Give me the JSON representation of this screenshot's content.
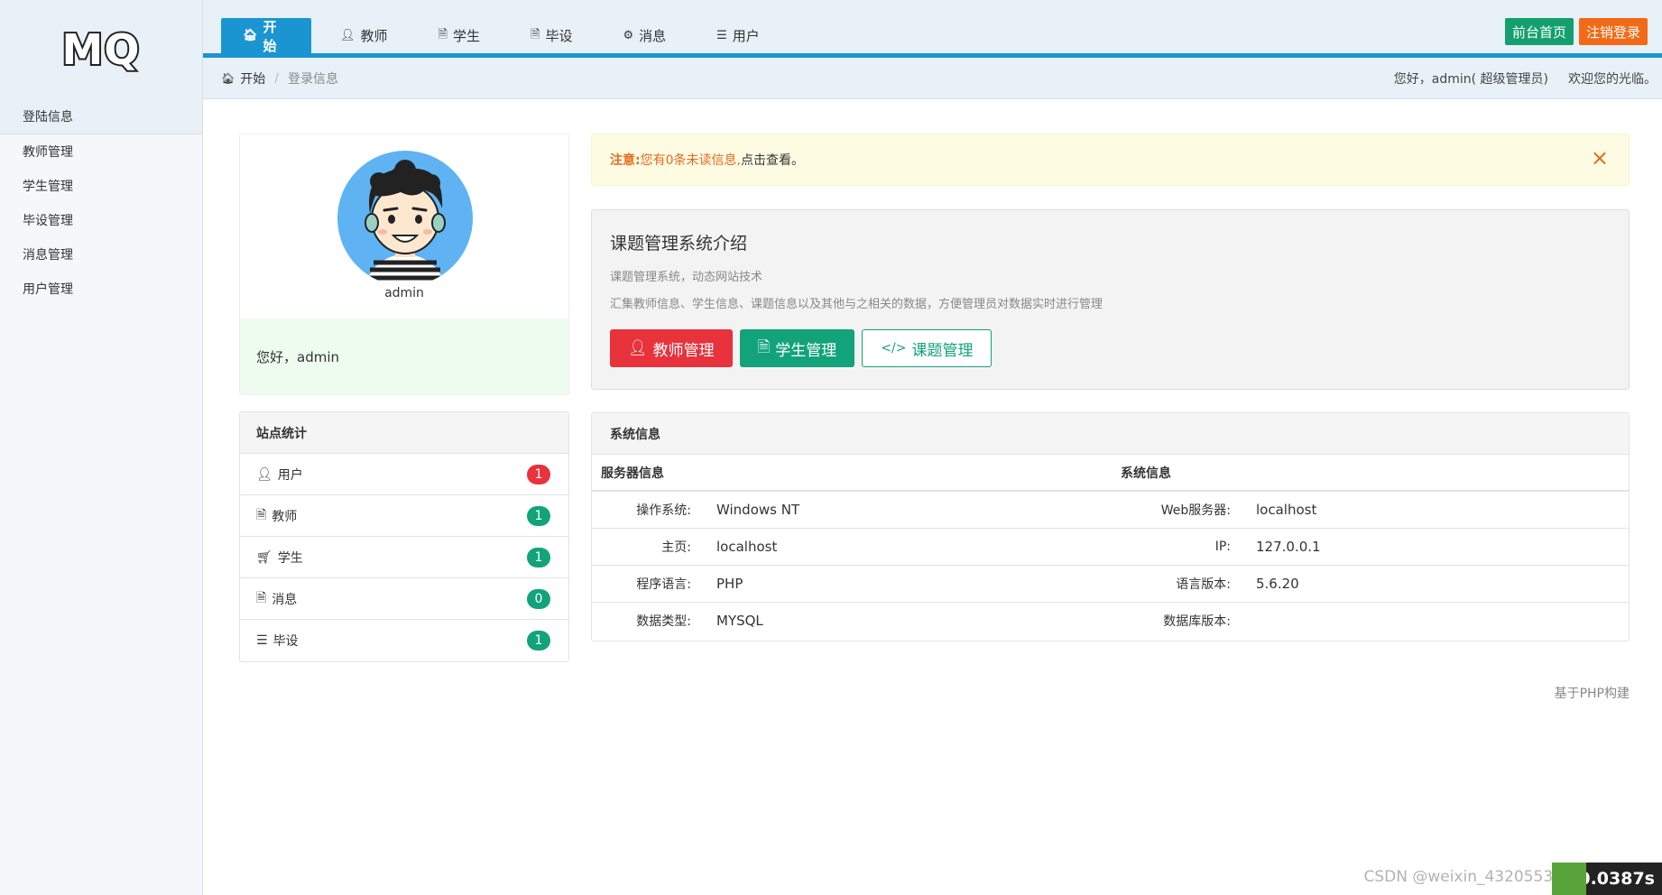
{
  "logo": "MQ",
  "nav": {
    "tabs": [
      {
        "label": "开始",
        "icon": "home-icon"
      },
      {
        "label": "教师",
        "icon": "user-icon"
      },
      {
        "label": "学生",
        "icon": "file-icon"
      },
      {
        "label": "毕设",
        "icon": "file-icon"
      },
      {
        "label": "消息",
        "icon": "gear-icon"
      },
      {
        "label": "用户",
        "icon": "list-icon"
      }
    ],
    "front_home": "前台首页",
    "logout": "注销登录"
  },
  "breadcrumb": {
    "home": "开始",
    "current": "登录信息"
  },
  "welcome": {
    "greeting": "您好，admin( 超级管理员)",
    "message": "欢迎您的光临。"
  },
  "sidebar": {
    "items": [
      {
        "label": "登陆信息"
      },
      {
        "label": "教师管理"
      },
      {
        "label": "学生管理"
      },
      {
        "label": "毕设管理"
      },
      {
        "label": "消息管理"
      },
      {
        "label": "用户管理"
      }
    ]
  },
  "profile": {
    "name": "admin",
    "hello": "您好，admin"
  },
  "stats": {
    "title": "站点统计",
    "rows": [
      {
        "label": "用户",
        "icon": "user-icon",
        "count": "1",
        "color": "#e8323c"
      },
      {
        "label": "教师",
        "icon": "file-icon",
        "count": "1",
        "color": "#12a37a"
      },
      {
        "label": "学生",
        "icon": "cart-icon",
        "count": "1",
        "color": "#12a37a"
      },
      {
        "label": "消息",
        "icon": "file-text-icon",
        "count": "0",
        "color": "#12a37a"
      },
      {
        "label": "毕设",
        "icon": "database-icon",
        "count": "1",
        "color": "#12a37a"
      }
    ]
  },
  "alert": {
    "prefix": "注意:",
    "text": "您有0条未读信息,",
    "link": "点击查看。",
    "close": "×"
  },
  "intro": {
    "title": "课题管理系统介绍",
    "line1": "课题管理系统，动态网站技术",
    "line2": "汇集教师信息、学生信息、课题信息以及其他与之相关的数据，方便管理员对数据实时进行管理",
    "btn_teacher": "教师管理",
    "btn_student": "学生管理",
    "btn_topic": "课题管理"
  },
  "sysinfo": {
    "title": "系统信息",
    "col_left": "服务器信息",
    "col_right": "系统信息",
    "rows": [
      {
        "k1": "操作系统:",
        "v1": "Windows NT",
        "k2": "Web服务器:",
        "v2": "localhost"
      },
      {
        "k1": "主页:",
        "v1": "localhost",
        "k2": "IP:",
        "v2": "127.0.0.1"
      },
      {
        "k1": "程序语言:",
        "v1": "PHP",
        "k2": "语言版本:",
        "v2": "5.6.20"
      },
      {
        "k1": "数据类型:",
        "v1": "MYSQL",
        "k2": "数据库版本:",
        "v2": ""
      }
    ]
  },
  "footer": "基于PHP构建",
  "watermark": "CSDN @weixin_43205539",
  "timer": "0.0387s"
}
